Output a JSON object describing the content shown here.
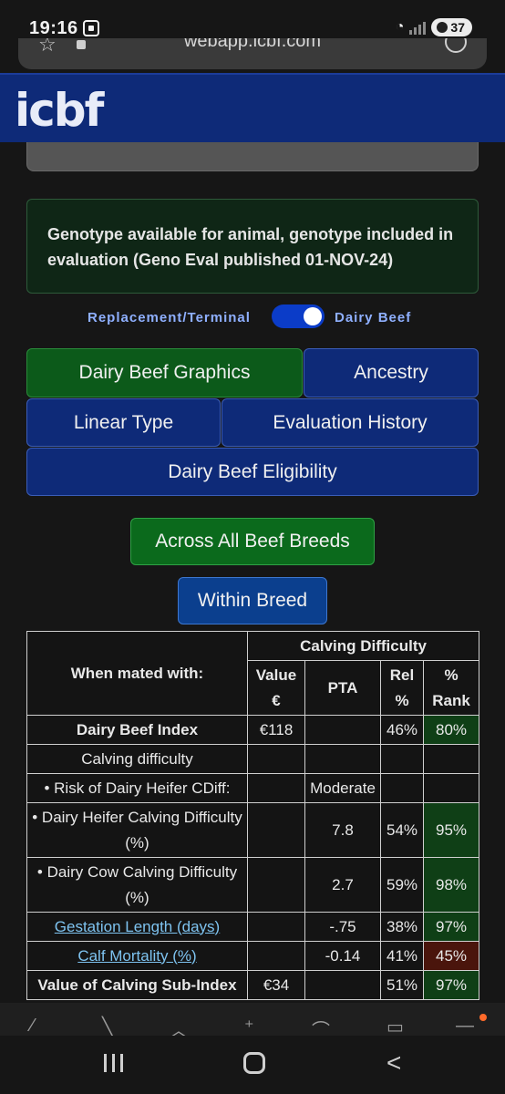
{
  "status_bar": {
    "time": "19:16",
    "battery": "37"
  },
  "browser": {
    "url": "webapp.icbf.com"
  },
  "header": {
    "logo": "icbf"
  },
  "alert": {
    "text": "Genotype available for animal, genotype included in evaluation (Geno Eval published 01-NOV-24)"
  },
  "toggle": {
    "left_label": "Replacement/Terminal",
    "right_label": "Dairy Beef",
    "state": "on"
  },
  "nav_buttons": {
    "dairy_beef_graphics": "Dairy Beef Graphics",
    "ancestry": "Ancestry",
    "linear_type": "Linear Type",
    "evaluation_history": "Evaluation History",
    "dairy_beef_eligibility": "Dairy Beef Eligibility"
  },
  "breed_buttons": {
    "across": "Across All Beef Breeds",
    "within": "Within Breed"
  },
  "table": {
    "corner": "When mated with:",
    "group_header": "Calving Difficulty",
    "columns": {
      "value": "Value €",
      "pta": "PTA",
      "rel": "Rel %",
      "rank": "% Rank"
    },
    "rows": [
      {
        "label": "Dairy Beef Index",
        "value": "€118",
        "pta": "",
        "rel": "46%",
        "rank": "80%"
      },
      {
        "label": "Calving difficulty",
        "value": "",
        "pta": "",
        "rel": "",
        "rank": ""
      },
      {
        "label": "• Risk of Dairy Heifer CDiff:",
        "value": "",
        "pta": "Moderate",
        "rel": "",
        "rank": ""
      },
      {
        "label": "• Dairy Heifer Calving Difficulty (%)",
        "value": "",
        "pta": "7.8",
        "rel": "54%",
        "rank": "95%"
      },
      {
        "label": "• Dairy Cow Calving Difficulty (%)",
        "value": "",
        "pta": "2.7",
        "rel": "59%",
        "rank": "98%"
      },
      {
        "label": "Gestation Length (days)",
        "value": "",
        "pta": "-.75",
        "rel": "38%",
        "rank": "97%"
      },
      {
        "label": "Calf Mortality (%)",
        "value": "",
        "pta": "-0.14",
        "rel": "41%",
        "rank": "45%"
      },
      {
        "label": "Value of Calving Sub-Index",
        "value": "€34",
        "pta": "",
        "rel": "51%",
        "rank": "97%"
      }
    ]
  },
  "colors": {
    "header": "#0e2a78",
    "active_button": "#0c5a1a",
    "rank_good": "#0f3f16",
    "rank_bad": "#4a150c",
    "link": "#7ec3f0"
  }
}
